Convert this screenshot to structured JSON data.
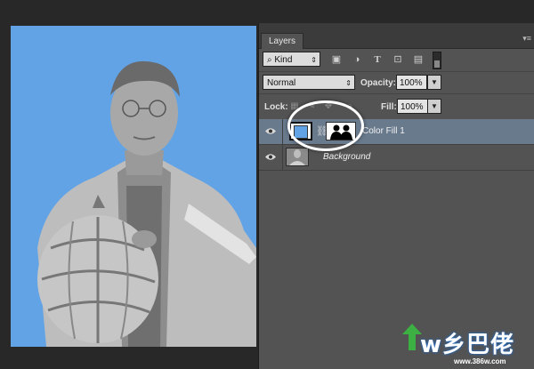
{
  "panel": {
    "tab_label": "Layers",
    "menu_icon": "panel-menu-icon"
  },
  "filter": {
    "kind_label": "Kind",
    "icons": [
      "pixel-filter-icon",
      "adjustment-filter-icon",
      "type-filter-icon",
      "shape-filter-icon",
      "smart-object-filter-icon"
    ]
  },
  "blending": {
    "mode": "Normal",
    "opacity_label": "Opacity:",
    "opacity_value": "100%"
  },
  "lock": {
    "label": "Lock:",
    "fill_label": "Fill:",
    "fill_value": "100%"
  },
  "layers": [
    {
      "name": "Color Fill 1",
      "visible": true,
      "selected": true,
      "fill_color": "#62a3e6"
    },
    {
      "name": "Background",
      "visible": true,
      "selected": false
    }
  ],
  "watermark": {
    "text": "w乡巴佬",
    "url": "www.386w.com"
  },
  "colors": {
    "document_fill": "#62a3e6",
    "panel_bg": "#535353",
    "selection": "#697a8d"
  }
}
